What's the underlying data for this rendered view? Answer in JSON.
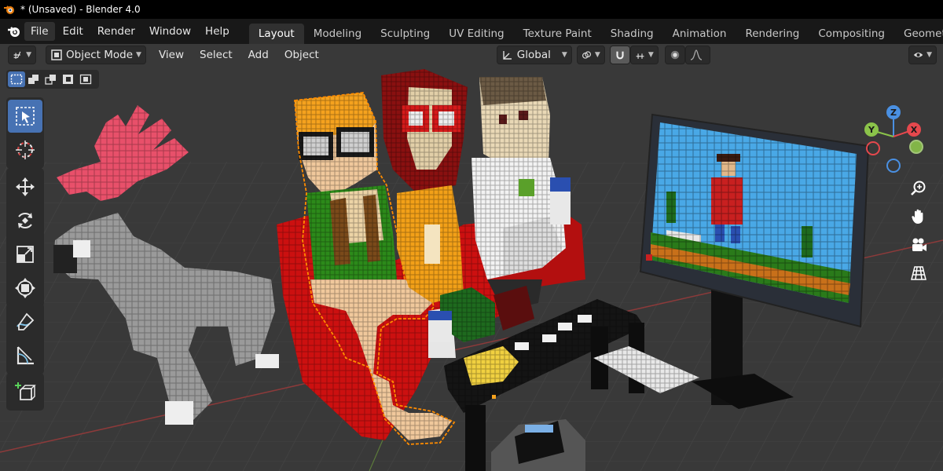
{
  "window": {
    "title": "* (Unsaved) - Blender 4.0"
  },
  "menu": {
    "file": "File",
    "edit": "Edit",
    "render": "Render",
    "window": "Window",
    "help": "Help"
  },
  "workspaces": [
    "Layout",
    "Modeling",
    "Sculpting",
    "UV Editing",
    "Texture Paint",
    "Shading",
    "Animation",
    "Rendering",
    "Compositing",
    "Geometry Node"
  ],
  "header": {
    "mode": "Object Mode",
    "view": "View",
    "select": "Select",
    "add": "Add",
    "object": "Object",
    "transform_orientation": "Global"
  },
  "gizmo": {
    "z": "Z",
    "y": "Y",
    "x": "X"
  },
  "colors": {
    "accent": "#4772b3",
    "viewport_bg": "#393939",
    "selection_outline": "#ff8c00",
    "axis_x": "#e5484d",
    "axis_y": "#8bc34a",
    "axis_z": "#4a90e2"
  },
  "icons": {
    "title": "blender-logo-icon",
    "tools": [
      "select-box-icon",
      "cursor-icon",
      "move-icon",
      "rotate-icon",
      "scale-icon",
      "transform-icon",
      "annotate-icon",
      "measure-icon",
      "add-cube-icon"
    ],
    "nav": [
      "zoom-icon",
      "pan-hand-icon",
      "camera-icon",
      "perspective-grid-icon"
    ]
  }
}
